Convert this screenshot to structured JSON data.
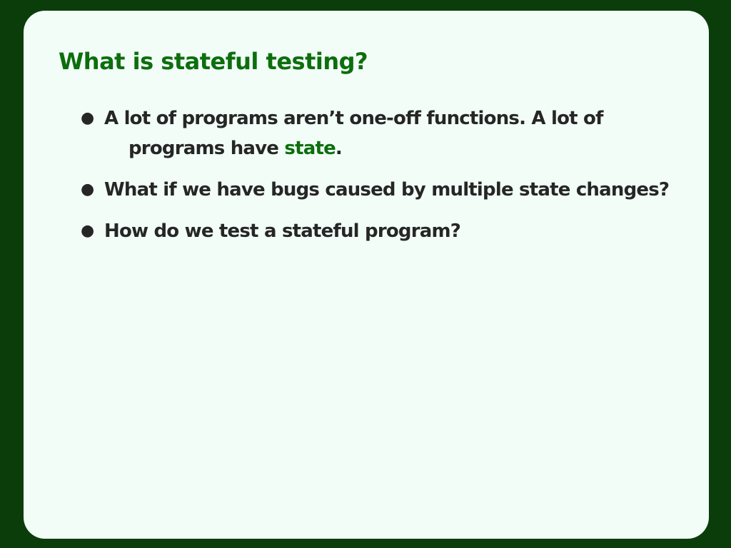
{
  "slide": {
    "title": "What is stateful testing?",
    "bullets": [
      {
        "line1": "A lot of programs aren’t one-off functions. A lot of",
        "line2_prefix": "programs have ",
        "line2_highlight": "state",
        "line2_suffix": "."
      },
      {
        "text": "What if we have bugs caused by multiple state changes?"
      },
      {
        "text": "How do we test a stateful program?"
      }
    ]
  },
  "colors": {
    "frame": "#0b3d0b",
    "slide_background": "#f2fdf8",
    "title": "#0d6e0d",
    "body_text": "#262626",
    "highlight": "#0d6e0d"
  }
}
